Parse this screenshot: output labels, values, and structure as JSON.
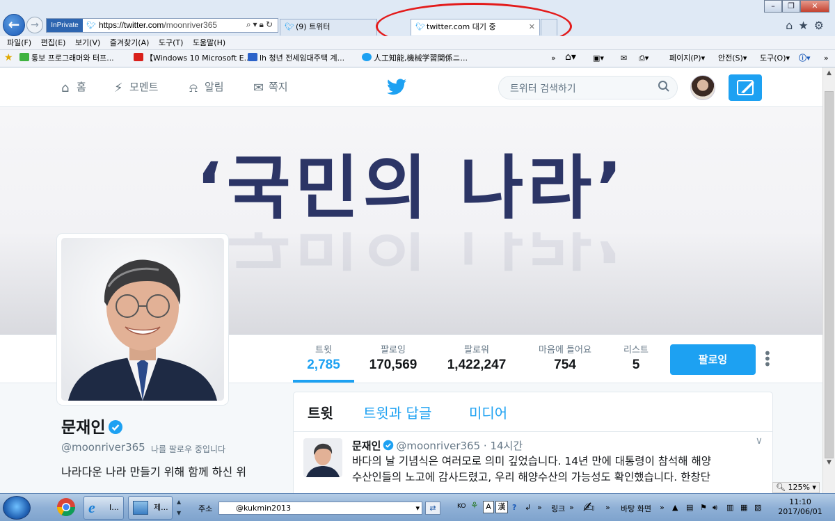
{
  "browser": {
    "inprivate": "InPrivate",
    "url_main": "https://twitter.com",
    "url_path": "/moonriver365",
    "tabs": [
      {
        "label": "(9) 트위터",
        "active": false
      },
      {
        "label": "twitter.com 대기 중",
        "active": true
      }
    ],
    "menu": [
      "파일(F)",
      "편집(E)",
      "보기(V)",
      "즐겨찾기(A)",
      "도구(T)",
      "도움말(H)"
    ],
    "favorites": [
      {
        "label": "통보 프로그래머와 터프...",
        "color": "#3fb23f"
      },
      {
        "label": "【Windows 10 Microsoft E...",
        "color": "#d9201b"
      },
      {
        "label": "lh 청년 전세임대주택 계...",
        "color": "#2b62c9"
      },
      {
        "label": "人工知能,機械学習関係ニ...",
        "color": "#1da1f2"
      }
    ],
    "commands": [
      "페이지(P)",
      "안전(S)",
      "도구(O)"
    ],
    "zoom": "125%"
  },
  "twitter": {
    "nav": {
      "home": "홈",
      "moments": "모멘트",
      "notifications": "알림",
      "messages": "쪽지",
      "search_placeholder": "트위터 검색하기"
    },
    "banner_text": "‘국민의 나라’",
    "stats": [
      {
        "label": "트윗",
        "value": "2,785",
        "active": true
      },
      {
        "label": "팔로잉",
        "value": "170,569",
        "active": false
      },
      {
        "label": "팔로워",
        "value": "1,422,247",
        "active": false
      },
      {
        "label": "마음에 들어요",
        "value": "754",
        "active": false
      },
      {
        "label": "리스트",
        "value": "5",
        "active": false
      }
    ],
    "follow_button": "팔로잉",
    "profile": {
      "name": "문재인",
      "handle": "@moonriver365",
      "follows_you": "나를 팔로우 중입니다",
      "bio": "나라다운 나라 만들기 위해 함께 하신 위"
    },
    "timeline_tabs": [
      "트윗",
      "트윗과 답글",
      "미디어"
    ],
    "tweet": {
      "name": "문재인",
      "handle": "@moonriver365",
      "time": "· 14시간",
      "line1": "바다의 날 기념식은 여러모로 의미 깊었습니다. 14년 만에 대통령이 참석해 해양",
      "line2": "수산인들의 노고에 감사드렸고, 우리 해양수산의 가능성도 확인했습니다. 한창단"
    }
  },
  "taskbar": {
    "ie_button": "I...",
    "folder_button": "제...",
    "address_label": "주소",
    "address_value": "@kukmin2013",
    "lang": "KO",
    "links": "링크",
    "desktop": "바탕 화면",
    "time": "11:10",
    "date": "2017/06/01"
  },
  "colors": {
    "twitter_blue": "#1da1f2",
    "banner_navy": "#2c3566",
    "annotation_red": "#e31b1b"
  }
}
